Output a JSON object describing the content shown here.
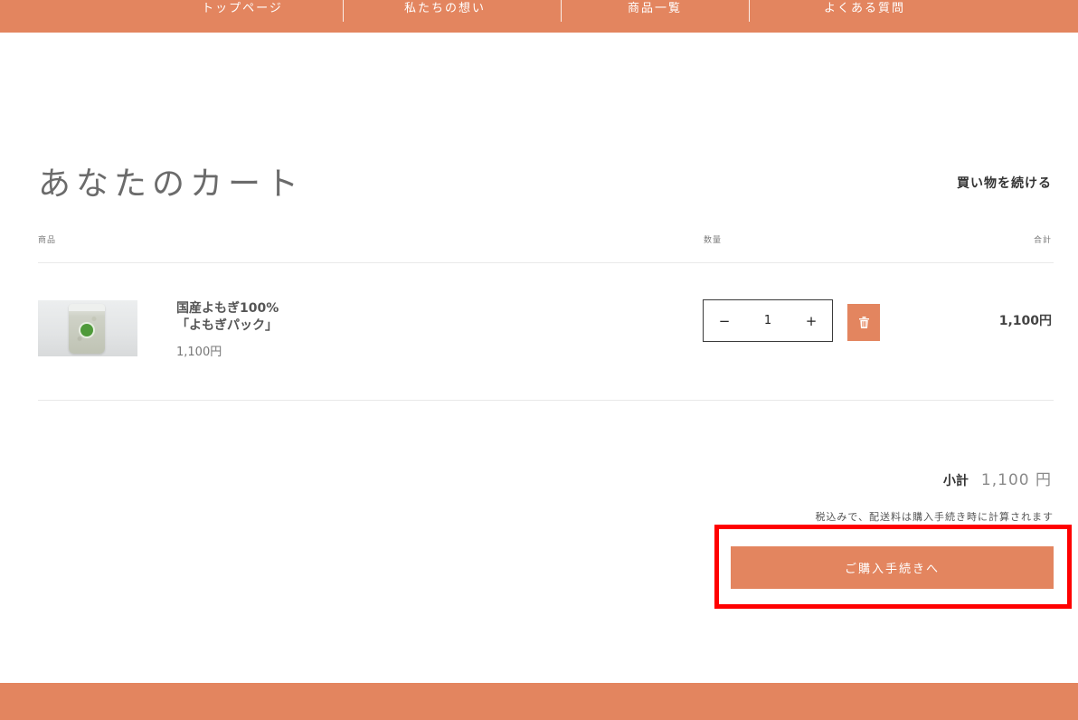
{
  "nav": {
    "items": [
      {
        "label": "トップページ"
      },
      {
        "label": "私たちの想い"
      },
      {
        "label": "商品一覧"
      },
      {
        "label": "よくある質問"
      }
    ]
  },
  "cart": {
    "title": "あなたのカート",
    "continue_label": "買い物を続ける",
    "headers": {
      "product": "商品",
      "quantity": "数量",
      "total": "合計"
    },
    "items": [
      {
        "name_line1": "国産よもぎ100%",
        "name_line2": "「よもぎパック」",
        "price": "1,100円",
        "quantity": "1",
        "line_total": "1,100円"
      }
    ],
    "qty_minus_label": "−",
    "qty_plus_label": "+"
  },
  "summary": {
    "subtotal_label": "小計",
    "subtotal_value": "1,100 円",
    "tax_note": "税込みで、配送料は購入手続き時に計算されます",
    "checkout_label": "ご購入手続きへ"
  },
  "icons": {
    "delete": "trash-icon",
    "product_image": "product-image"
  },
  "colors": {
    "brand": "#E3855F",
    "highlight": "#FF0000",
    "text": "#555555"
  }
}
